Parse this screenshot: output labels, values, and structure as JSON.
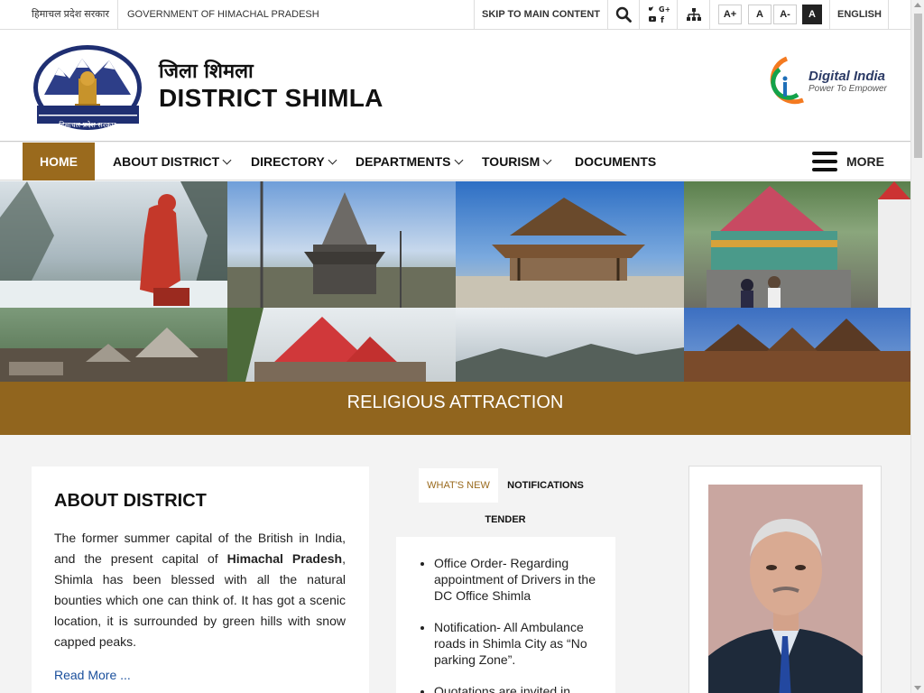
{
  "topbar": {
    "hindi_gov": "हिमाचल प्रदेश सरकार",
    "english_gov": "GOVERNMENT OF HIMACHAL PRADESH",
    "skip_label": "SKIP TO MAIN CONTENT",
    "font_increase": "A+",
    "font_normal": "A",
    "font_decrease": "A-",
    "contrast": "A",
    "language": "ENGLISH"
  },
  "header": {
    "title_hindi": "जिला शिमला",
    "title_english": "DISTRICT SHIMLA",
    "emblem_caption": "हिमाचल प्रदेश सरकार",
    "digital_india": "Digital India",
    "digital_tagline": "Power To Empower"
  },
  "nav": {
    "items": [
      {
        "label": "HOME"
      },
      {
        "label": "ABOUT DISTRICT"
      },
      {
        "label": "DIRECTORY"
      },
      {
        "label": "DEPARTMENTS"
      },
      {
        "label": "TOURISM"
      },
      {
        "label": "DOCUMENTS"
      }
    ],
    "more_label": "MORE"
  },
  "banner": {
    "caption": "RELIGIOUS ATTRACTION"
  },
  "about": {
    "heading": "ABOUT DISTRICT",
    "text_1": "The former summer capital of the British in India, and the present capital of ",
    "text_bold": "Himachal Pradesh",
    "text_2": ", Shimla has been blessed with all the natural bounties which one can think of. It has got a scenic location, it is surrounded by green hills with snow capped peaks.",
    "read_more": "Read More ..."
  },
  "updates": {
    "tabs": [
      {
        "label": "WHAT'S NEW"
      },
      {
        "label": "NOTIFICATIONS"
      },
      {
        "label": "TENDER"
      }
    ],
    "items": [
      {
        "text": "Office Order- Regarding appointment of Drivers in the DC Office Shimla"
      },
      {
        "text": "Notification- All Ambulance roads in Shimla City as “No parking Zone”."
      },
      {
        "text": "Quotations are invited in"
      }
    ]
  },
  "colors": {
    "accent": "#9a6a1d",
    "link": "#1a4f9c"
  }
}
